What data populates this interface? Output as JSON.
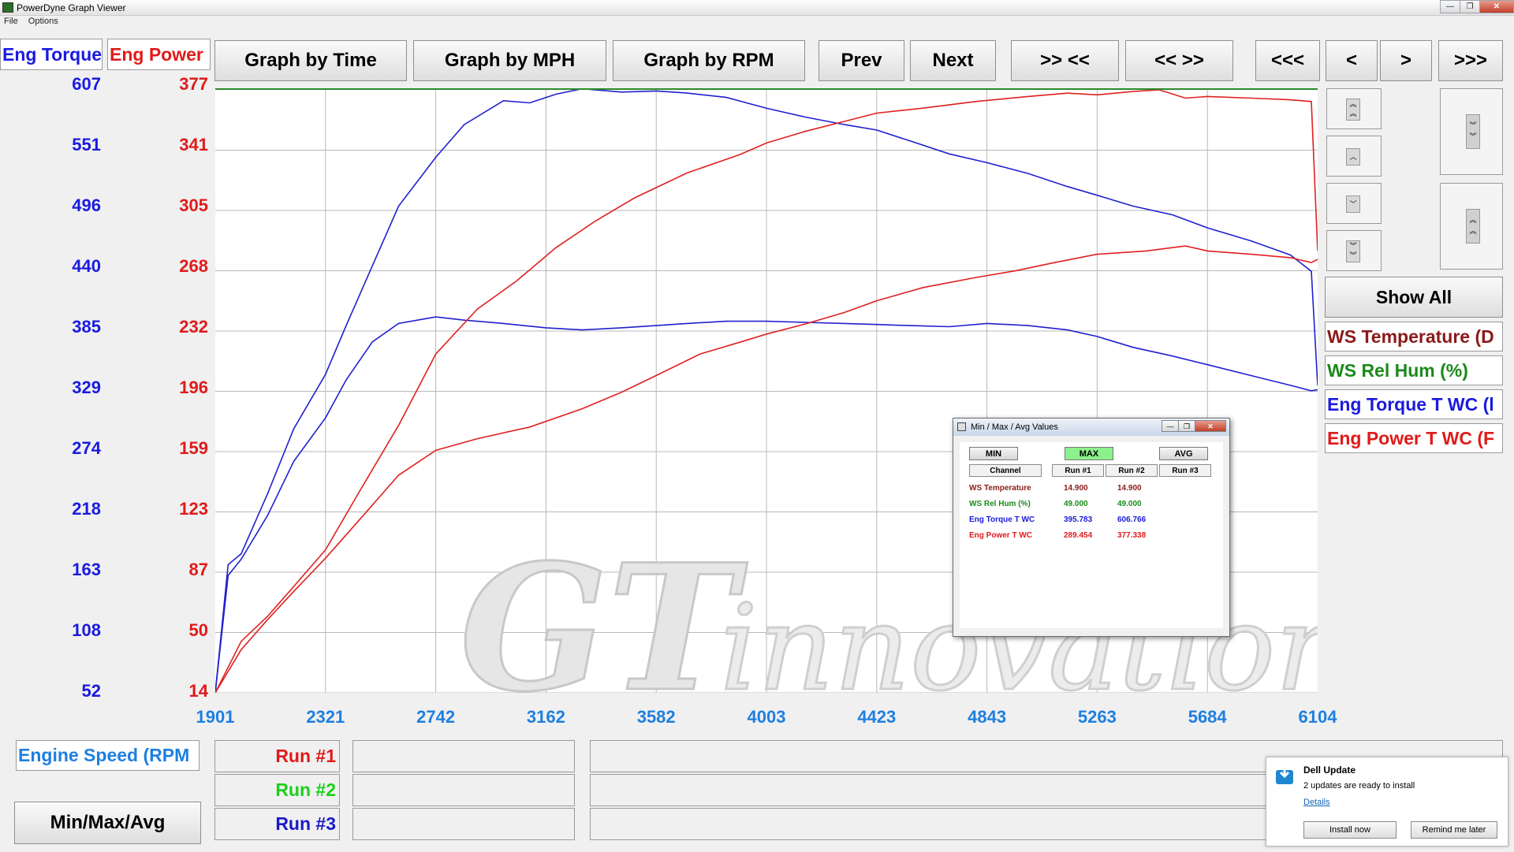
{
  "window": {
    "title": "PowerDyne Graph Viewer"
  },
  "menu": [
    "File",
    "Options"
  ],
  "channel_labels": {
    "torque": "Eng Torque",
    "power": "Eng Power"
  },
  "toolbar": {
    "graph_by_time": "Graph by Time",
    "graph_by_mph": "Graph by MPH",
    "graph_by_rpm": "Graph by RPM",
    "prev": "Prev",
    "next": "Next",
    "zoom_in": ">> <<",
    "zoom_out": "<< >>",
    "first": "<<<",
    "left": "<",
    "right": ">",
    "last": ">>>"
  },
  "right_panel": {
    "show_all": "Show All",
    "channels": [
      {
        "label": "WS Temperature (D",
        "color": "#8b1a1a"
      },
      {
        "label": "WS Rel Hum (%)",
        "color": "#1a8a1a"
      },
      {
        "label": "Eng Torque T WC (l",
        "color": "#1a1ae0"
      },
      {
        "label": "Eng Power T WC (F",
        "color": "#e01a1a"
      }
    ]
  },
  "axes": {
    "torque_ticks": [
      "607",
      "551",
      "496",
      "440",
      "385",
      "329",
      "274",
      "218",
      "163",
      "108",
      "52"
    ],
    "power_ticks": [
      "377",
      "341",
      "305",
      "268",
      "232",
      "196",
      "159",
      "123",
      "87",
      "50",
      "14"
    ],
    "x_ticks": [
      "1901",
      "2321",
      "2742",
      "3162",
      "3582",
      "4003",
      "4423",
      "4843",
      "5263",
      "5684",
      "6104"
    ]
  },
  "chart_data": {
    "type": "line",
    "xlabel": "Engine Speed (RPM",
    "xlim": [
      1901,
      6104
    ],
    "torque_axis": [
      52,
      607
    ],
    "power_axis": [
      14,
      377
    ],
    "series": [
      {
        "name": "Run #1",
        "channel": "Eng Torque T WC",
        "axis": "torque",
        "color": "#2020d0",
        "x": [
          1901,
          1950,
          2000,
          2100,
          2200,
          2321,
          2400,
          2500,
          2600,
          2742,
          2850,
          3000,
          3162,
          3300,
          3450,
          3582,
          3700,
          3850,
          4003,
          4150,
          4300,
          4423,
          4550,
          4700,
          4843,
          5000,
          5150,
          5263,
          5400,
          5550,
          5684,
          5850,
          6000,
          6080,
          6104
        ],
        "y": [
          52,
          160,
          175,
          215,
          265,
          305,
          340,
          375,
          392,
          398,
          395,
          392,
          388,
          386,
          388,
          390,
          392,
          394,
          394,
          393,
          392,
          391,
          390,
          389,
          392,
          390,
          386,
          380,
          370,
          362,
          354,
          344,
          335,
          330,
          331
        ]
      },
      {
        "name": "Run #2",
        "channel": "Eng Torque T WC",
        "axis": "torque",
        "color": "#2020d0",
        "x": [
          1901,
          1950,
          2000,
          2100,
          2200,
          2321,
          2400,
          2500,
          2600,
          2742,
          2850,
          3000,
          3100,
          3200,
          3300,
          3450,
          3582,
          3700,
          3850,
          4003,
          4150,
          4300,
          4423,
          4550,
          4700,
          4843,
          5000,
          5150,
          5263,
          5400,
          5550,
          5684,
          5850,
          6000,
          6080,
          6104
        ],
        "y": [
          52,
          170,
          180,
          235,
          295,
          345,
          390,
          445,
          500,
          545,
          575,
          597,
          595,
          603,
          608,
          605,
          606,
          604,
          600,
          590,
          582,
          575,
          570,
          560,
          548,
          540,
          530,
          518,
          510,
          500,
          492,
          480,
          468,
          455,
          440,
          335
        ]
      },
      {
        "name": "Run #1",
        "channel": "Eng Power T WC",
        "axis": "power",
        "color": "#e02020",
        "x": [
          1901,
          2000,
          2100,
          2200,
          2321,
          2450,
          2600,
          2742,
          2900,
          3100,
          3300,
          3450,
          3582,
          3750,
          3900,
          4003,
          4150,
          4300,
          4423,
          4600,
          4800,
          4950,
          5100,
          5263,
          5450,
          5600,
          5684,
          5850,
          6000,
          6080,
          6104
        ],
        "y": [
          14,
          40,
          58,
          75,
          95,
          118,
          145,
          160,
          167,
          174,
          185,
          195,
          205,
          218,
          225,
          230,
          236,
          243,
          250,
          258,
          264,
          268,
          273,
          278,
          280,
          283,
          280,
          278,
          276,
          273,
          275
        ]
      },
      {
        "name": "Run #2",
        "channel": "Eng Power T WC",
        "axis": "power",
        "color": "#e02020",
        "x": [
          1901,
          2000,
          2100,
          2200,
          2321,
          2450,
          2600,
          2742,
          2900,
          3050,
          3200,
          3350,
          3500,
          3700,
          3900,
          4003,
          4150,
          4300,
          4423,
          4600,
          4800,
          5000,
          5150,
          5263,
          5400,
          5500,
          5600,
          5684,
          5850,
          6000,
          6080,
          6104
        ],
        "y": [
          14,
          45,
          60,
          78,
          100,
          135,
          175,
          218,
          245,
          262,
          282,
          298,
          312,
          327,
          338,
          345,
          352,
          358,
          363,
          366,
          370,
          373,
          375,
          374,
          376,
          377,
          372,
          373,
          372,
          371,
          370,
          280
        ]
      }
    ]
  },
  "bottom": {
    "xaxis_label": "Engine Speed (RPM",
    "minmax_button": "Min/Max/Avg",
    "runs": [
      {
        "label": "Run #1",
        "color": "#e01a1a"
      },
      {
        "label": "Run #2",
        "color": "#1ad01a"
      },
      {
        "label": "Run #3",
        "color": "#1a1ac8"
      }
    ]
  },
  "minmax_dialog": {
    "title": "Min / Max / Avg Values",
    "buttons": {
      "min": "MIN",
      "max": "MAX",
      "avg": "AVG"
    },
    "headers": [
      "Channel",
      "Run #1",
      "Run #2",
      "Run #3"
    ],
    "rows": [
      {
        "channel": "WS Temperature",
        "run1": "14.900",
        "run2": "14.900",
        "run3": "",
        "color": "#8b1a1a"
      },
      {
        "channel": "WS Rel Hum (%)",
        "run1": "49.000",
        "run2": "49.000",
        "run3": "",
        "color": "#1a8a1a"
      },
      {
        "channel": "Eng Torque T WC",
        "run1": "395.783",
        "run2": "606.766",
        "run3": "",
        "color": "#1a1ae0"
      },
      {
        "channel": "Eng Power T WC",
        "run1": "289.454",
        "run2": "377.338",
        "run3": "",
        "color": "#e01a1a"
      }
    ]
  },
  "toast": {
    "title": "Dell Update",
    "message": "2 updates are ready to install",
    "link": "Details",
    "install": "Install now",
    "remind": "Remind me later"
  },
  "watermark": "GTinnovation"
}
